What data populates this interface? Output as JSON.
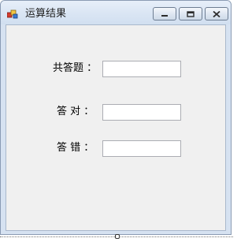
{
  "window": {
    "title": "运算结果"
  },
  "form": {
    "fields": [
      {
        "label": "共答题 ：",
        "value": ""
      },
      {
        "label": "答 对 ：",
        "value": ""
      },
      {
        "label": "答 错 ：",
        "value": ""
      }
    ]
  },
  "icons": {
    "app": "app-icon",
    "minimize": "minimize-icon",
    "maximize": "maximize-icon",
    "close": "close-icon"
  }
}
